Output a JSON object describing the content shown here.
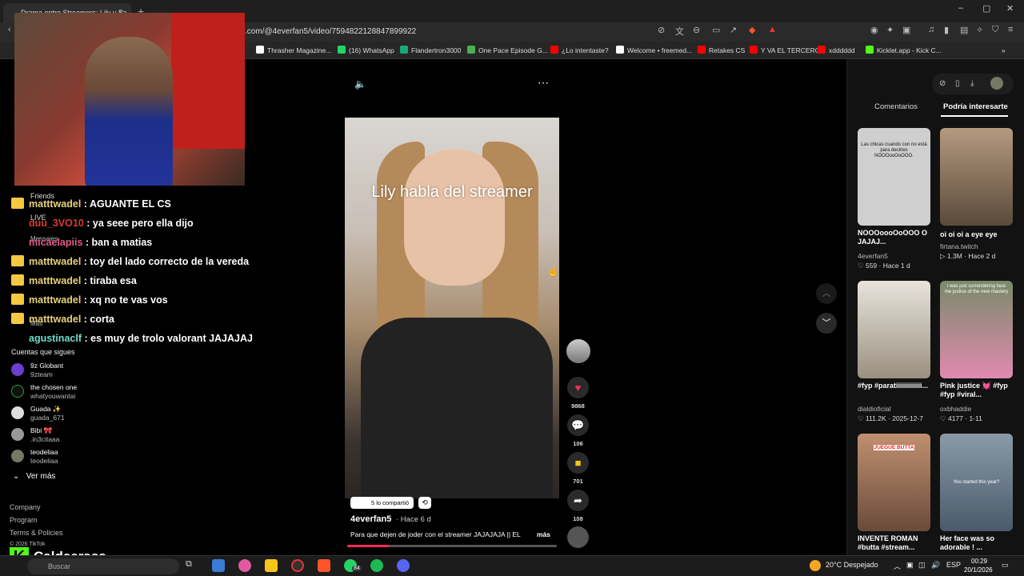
{
  "browser": {
    "tab_title": "Drama entre Streamers: Lily y Fa",
    "tab_close": "×",
    "new_tab": "+",
    "url": ".com/@4everfan5/video/7594822128847899922",
    "window_controls": [
      "–",
      "▢",
      "✕"
    ],
    "bookmarks": [
      {
        "label": "Thrasher Magazine...",
        "color": "#ffffff"
      },
      {
        "label": "(16) WhatsApp",
        "color": "#25d366"
      },
      {
        "label": "Flandertron3000",
        "color": "#19a974"
      },
      {
        "label": "One Pace Episode G...",
        "color": "#4caf50"
      },
      {
        "label": "¿Lo intentaste?",
        "color": "#ff0000"
      },
      {
        "label": "Welcome • freemed...",
        "color": "#ffffff"
      },
      {
        "label": "Retakes CS",
        "color": "#ff0000"
      },
      {
        "label": "Y VA EL TERCERO",
        "color": "#ff0000"
      },
      {
        "label": "xdddddd",
        "color": "#ff0000"
      },
      {
        "label": "Kicklet.app - Kick C...",
        "color": "#53fc18"
      }
    ]
  },
  "sidebar": {
    "friends": "Friends",
    "live": "LIVE",
    "mensajes": "Mensajes",
    "mas": "Más",
    "following_title": "Cuentas que sigues",
    "following": [
      {
        "name": "9z Globant",
        "handle": "9zteam"
      },
      {
        "name": "the chosen one",
        "handle": "whatyouwantai"
      },
      {
        "name": "Guada ✨",
        "handle": "guada_671"
      },
      {
        "name": "Bibi 🎀",
        "handle": ".in3citaaa"
      },
      {
        "name": "teodeliaa",
        "handle": "teodeliaa"
      }
    ],
    "ver_mas": "Ver más",
    "footer": [
      "Company",
      "Program",
      "Terms & Policies",
      "© 2026 TikTok"
    ]
  },
  "chat": [
    {
      "user": "matttwadel",
      "msg": ": AGUANTE EL CS",
      "style": "gold",
      "icon": true
    },
    {
      "user": "duu_3VO10",
      "msg": ": ya seee pero ella dijo",
      "style": "red",
      "icon": false
    },
    {
      "user": "micaelapiis",
      "msg": ": ban a matias",
      "style": "pink",
      "icon": false
    },
    {
      "user": "matttwadel",
      "msg": ": toy del lado correcto de la vereda",
      "style": "gold",
      "icon": true
    },
    {
      "user": "matttwadel",
      "msg": ": tiraba esa",
      "style": "gold",
      "icon": true
    },
    {
      "user": "matttwadel",
      "msg": ": xq no te vas vos",
      "style": "gold",
      "icon": true
    },
    {
      "user": "matttwadel",
      "msg": ": corta",
      "style": "gold",
      "icon": true
    },
    {
      "user": "agustinaclf",
      "msg": ": es muy de trolo valorant JAJAJAJ",
      "style": "teal",
      "icon": false
    }
  ],
  "brand": {
    "logo": "K",
    "name": "Caldeerass"
  },
  "video": {
    "overlay_text": "Lily habla del streamer",
    "shared": "5 lo compartió",
    "author": "4everfan5",
    "time": "· Hace 6 d",
    "description": "Para que dejen de joder con el streamer JAJAJAJA || EL",
    "more": "más",
    "progress": 0.2
  },
  "actions": {
    "likes": "9868",
    "comments": "106",
    "saves": "701",
    "shares": "108"
  },
  "right_panel": {
    "tab_comments": "Comentarios",
    "tab_interest": "Podría interesarte",
    "cards": [
      {
        "title": "NOOOoooOoOOO O JAJAJ...",
        "author": "4everfan5",
        "stats": "♡ 559 · Hace 1 d",
        "thumb_text": "Las chicas cuando con no está para decirles NOOOooOoOOO.",
        "bg": "#cfcfcf"
      },
      {
        "title": "oi oi oi a eye eye",
        "author": "firtana.twitch",
        "stats": "▷ 1.3M · Hace 2 d",
        "thumb_text": "",
        "bg": "#8a7a6a"
      },
      {
        "title": "#fyp #paratiiiiiiiiiiiii...",
        "author": "dialdioficial",
        "stats": "♡ 111.2K · 2025-12-7",
        "thumb_text": "",
        "bg": "#bfb8ad"
      },
      {
        "title": "Pink justice 💓 #fyp #fyp #viral...",
        "author": "oxbhaddie",
        "stats": "♡ 4177 · 1-11",
        "thumb_text": "i was just surrendering face me justice of the new mastery",
        "bg": "#d07aa0"
      },
      {
        "title": "INVENTE ROMAN #butta #stream...",
        "author": "",
        "stats": "",
        "thumb_text": "JUEGUE BUTTA",
        "bg": "#a77a5a"
      },
      {
        "title": "Her face was so adorable ! ...",
        "author": "",
        "stats": "",
        "thumb_text": "You started this year?",
        "bg": "#6a7a8a"
      }
    ]
  },
  "taskbar": {
    "search": "Buscar",
    "badge": "84",
    "weather": "20°C  Despejado",
    "lang": "ESP",
    "time": "00:29",
    "date": "20/1/2026"
  }
}
